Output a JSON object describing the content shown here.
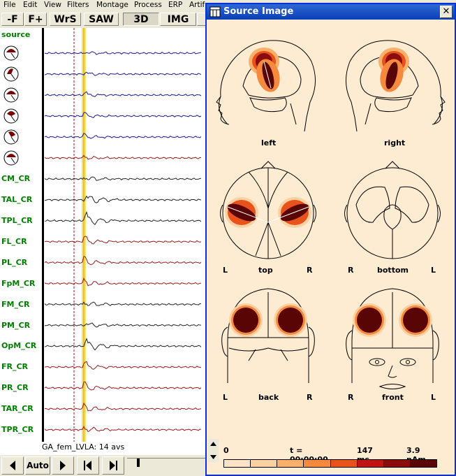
{
  "menu": {
    "items": [
      "File",
      "Edit",
      "View",
      "Filters",
      "Montage",
      "Process",
      "ERP",
      "Artif"
    ]
  },
  "toolbar": {
    "buttons": [
      "-F",
      "F+",
      "WrS",
      "SAW",
      "3D",
      "IMG"
    ]
  },
  "montage": {
    "source_label": "source",
    "channels": [
      "CM_CR",
      "TAL_CR",
      "TPL_CR",
      "FL_CR",
      "PL_CR",
      "FpM_CR",
      "FM_CR",
      "PM_CR",
      "OpM_CR",
      "FR_CR",
      "PR_CR",
      "TAR_CR",
      "TPR_CR"
    ],
    "status": "GA_fem_LVLA: 14 avs"
  },
  "nav": {
    "auto_label": "Auto"
  },
  "source_window": {
    "title": "Source Image",
    "close": "✕",
    "views": {
      "left": "left",
      "right": "right",
      "top": "top",
      "bottom": "bottom",
      "back": "back",
      "front": "front",
      "L": "L",
      "R": "R"
    },
    "colorbar": {
      "min": "0",
      "time": "t = 00:00:00",
      "latency": "147 ms",
      "max": "3.9 nAm",
      "colors": [
        "#fde3c8",
        "#fbd1a3",
        "#f8b06a",
        "#f58a3e",
        "#e9521b",
        "#c01414",
        "#8b0c0c",
        "#5a0505"
      ]
    }
  },
  "colors": {
    "channel_label": "#008000",
    "trace_blue": "#1a1a9a",
    "trace_red": "#9a1a1a",
    "highlight": "#f7e36c"
  }
}
